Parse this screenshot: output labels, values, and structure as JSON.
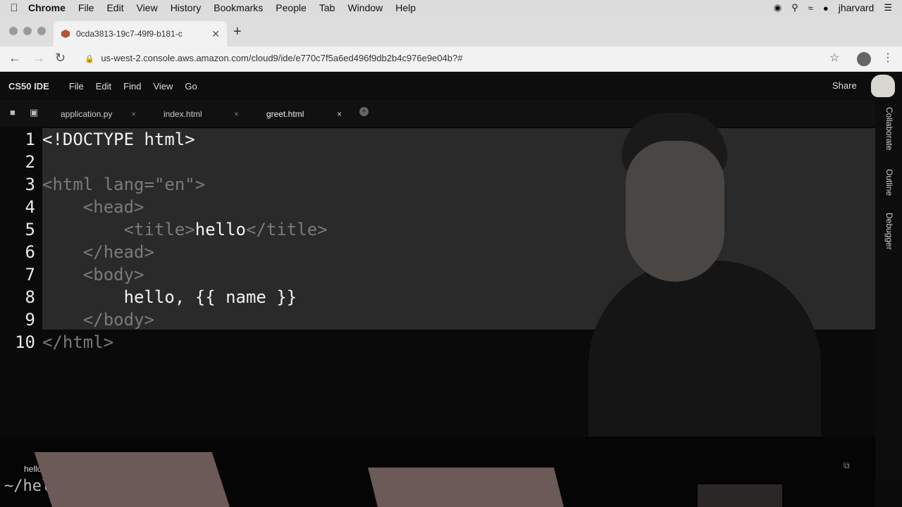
{
  "menubar": {
    "items": [
      "Chrome",
      "File",
      "Edit",
      "View",
      "History",
      "Bookmarks",
      "People",
      "Tab",
      "Window",
      "Help"
    ],
    "user": "jharvard"
  },
  "browser": {
    "tab_title": "0cda3813-19c7-49f9-b181-c",
    "url": "us-west-2.console.aws.amazon.com/cloud9/ide/e770c7f5a6ed496f9db2b4c976e9e04b?#"
  },
  "ide": {
    "brand": "CS50 IDE",
    "menu": [
      "File",
      "Edit",
      "Find",
      "View",
      "Go"
    ],
    "share": "Share",
    "tabs": [
      "application.py",
      "index.html",
      "greet.html"
    ],
    "side_panels": [
      "Collaborate",
      "Outline",
      "Debugger"
    ]
  },
  "editor": {
    "lines": [
      {
        "n": "1",
        "segs": [
          [
            "txt",
            "<!DOCTYPE html>"
          ]
        ]
      },
      {
        "n": "2",
        "segs": []
      },
      {
        "n": "3",
        "segs": [
          [
            "tag",
            "<html lang=\"en\">"
          ]
        ]
      },
      {
        "n": "4",
        "segs": [
          [
            "txt",
            "    "
          ],
          [
            "tag",
            "<head>"
          ]
        ]
      },
      {
        "n": "5",
        "segs": [
          [
            "txt",
            "        "
          ],
          [
            "tag",
            "<title>"
          ],
          [
            "txt",
            "hello"
          ],
          [
            "tag",
            "</title>"
          ]
        ]
      },
      {
        "n": "6",
        "segs": [
          [
            "txt",
            "    "
          ],
          [
            "tag",
            "</head>"
          ]
        ]
      },
      {
        "n": "7",
        "segs": [
          [
            "txt",
            "    "
          ],
          [
            "tag",
            "<body>"
          ]
        ]
      },
      {
        "n": "8",
        "segs": [
          [
            "txt",
            "        hello, {{ name }}"
          ]
        ]
      },
      {
        "n": "9",
        "segs": [
          [
            "txt",
            "    "
          ],
          [
            "tag",
            "</body>"
          ]
        ]
      },
      {
        "n": "10",
        "segs": [
          [
            "tag",
            "</html>"
          ]
        ]
      }
    ]
  },
  "terminal": {
    "tab": "hello/",
    "prompt": "~/hell"
  }
}
